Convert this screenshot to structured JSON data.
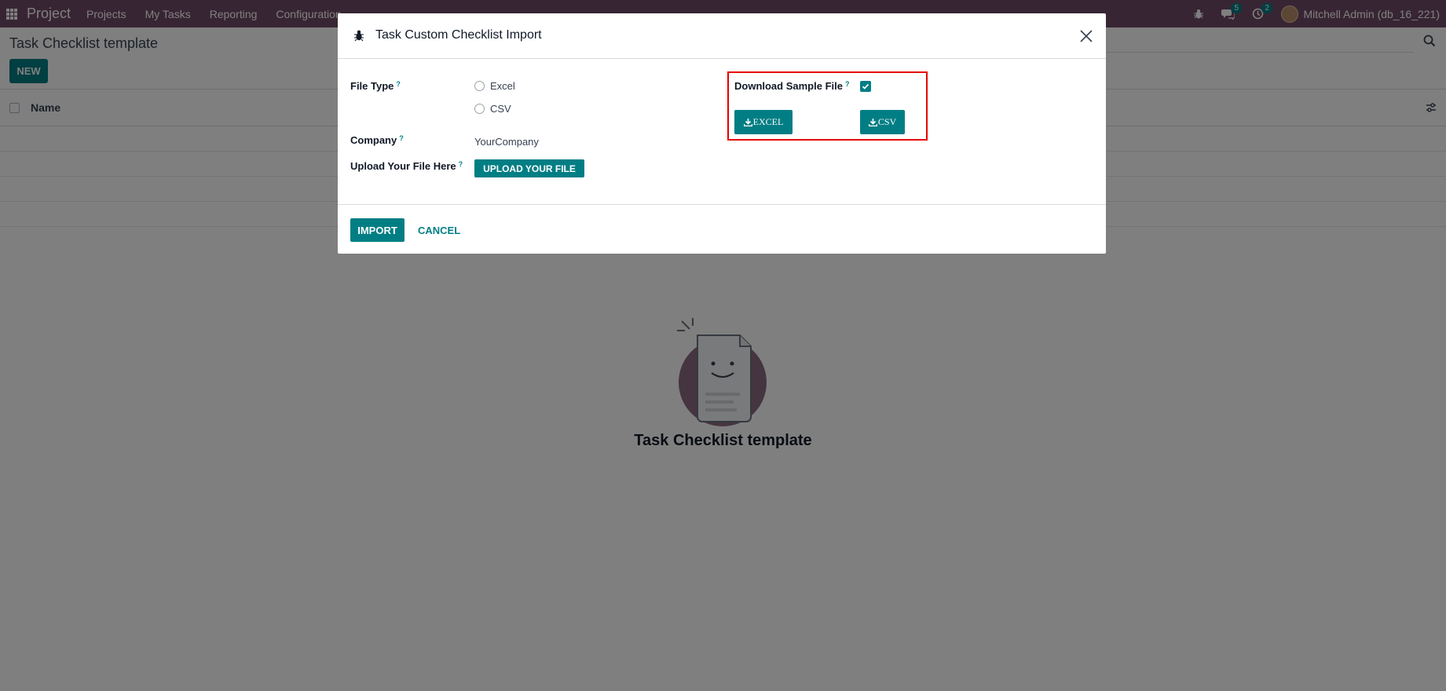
{
  "navbar": {
    "app_name": "Project",
    "menu": [
      "Projects",
      "My Tasks",
      "Reporting",
      "Configuration"
    ],
    "messages_count": "5",
    "activities_count": "2",
    "user_label": "Mitchell Admin (db_16_221)"
  },
  "page": {
    "title": "Task Checklist template",
    "new_label": "NEW",
    "column_name": "Name",
    "empty_title": "Task Checklist template"
  },
  "dialog": {
    "title": "Task Custom Checklist Import",
    "file_type_label": "File Type",
    "help_mark": "?",
    "file_type_options": [
      "Excel",
      "CSV"
    ],
    "company_label": "Company",
    "company_value": "YourCompany",
    "upload_label": "Upload Your File Here",
    "upload_button": "UPLOAD YOUR FILE",
    "download_sample_label": "Download Sample File",
    "download_sample_checked": true,
    "excel_button": "EXCEL",
    "csv_button": "CSV",
    "import_button": "IMPORT",
    "cancel_button": "CANCEL"
  },
  "colors": {
    "navbar": "#714B67",
    "primary": "#017e84",
    "highlight": "#e60000"
  }
}
